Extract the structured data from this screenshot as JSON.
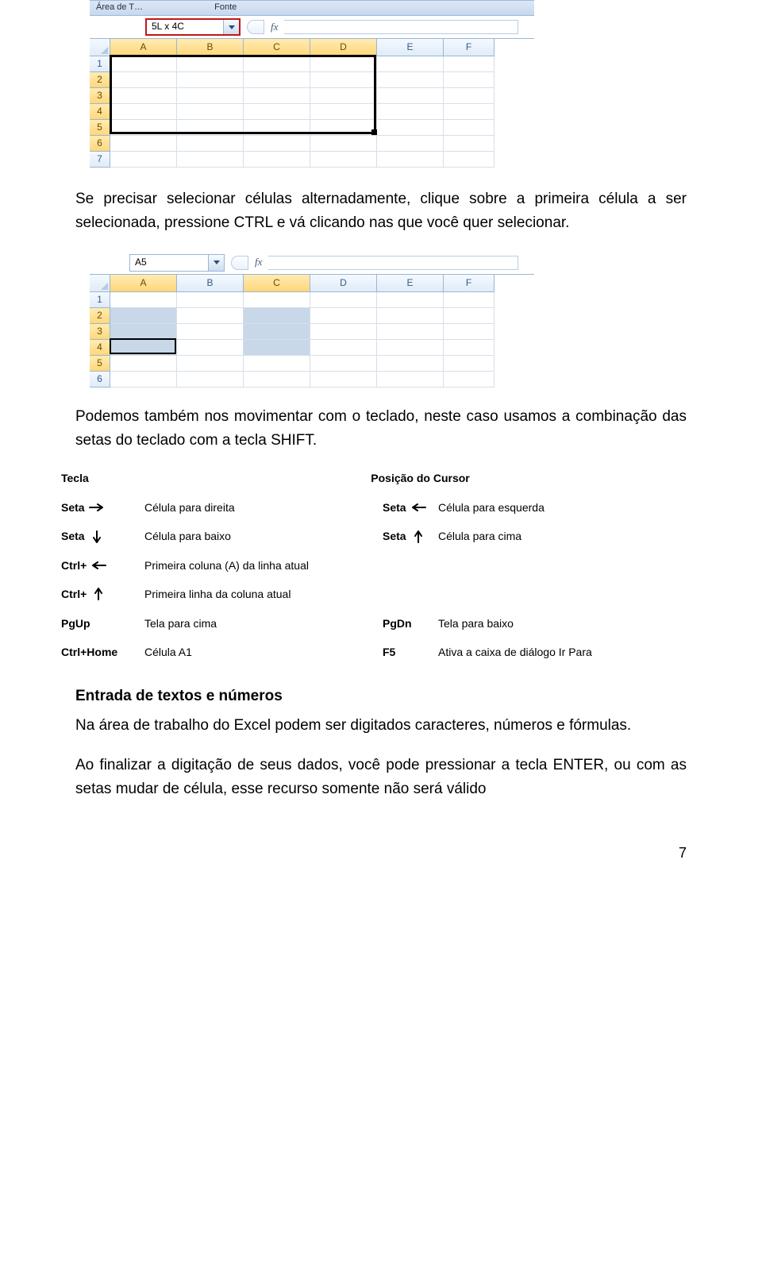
{
  "ribbon": {
    "label1": "Área de T…",
    "label2": "Fonte"
  },
  "shot1": {
    "namebox": "5L x 4C",
    "cols": [
      "A",
      "B",
      "C",
      "D",
      "E",
      "F"
    ],
    "rows": [
      "1",
      "2",
      "3",
      "4",
      "5",
      "6",
      "7"
    ]
  },
  "para1": "Se precisar selecionar células alternadamente, clique sobre a primeira célula a ser selecionada, pressione CTRL e vá clicando nas que você quer selecionar.",
  "shot2": {
    "namebox": "A5",
    "cols": [
      "A",
      "B",
      "C",
      "D",
      "E",
      "F"
    ],
    "rows": [
      "1",
      "2",
      "3",
      "4",
      "5",
      "6"
    ]
  },
  "para2": "Podemos também nos movimentar com o teclado, neste caso usamos a combinação das setas do teclado com a tecla SHIFT.",
  "kb": {
    "head_key": "Tecla",
    "head_pos": "Posição do Cursor",
    "rows": [
      {
        "k1": "Seta",
        "a1": "right",
        "d1": "Célula para direita",
        "k2": "Seta",
        "a2": "left",
        "d2": "Célula para esquerda"
      },
      {
        "k1": "Seta",
        "a1": "down",
        "d1": "Célula para baixo",
        "k2": "Seta",
        "a2": "up",
        "d2": "Célula para cima"
      },
      {
        "k1": "Ctrl+",
        "a1": "left",
        "d1": "Primeira coluna (A) da linha atual",
        "k2": "",
        "a2": "",
        "d2": ""
      },
      {
        "k1": "Ctrl+",
        "a1": "up",
        "d1": "Primeira linha da coluna atual",
        "k2": "",
        "a2": "",
        "d2": ""
      },
      {
        "k1": "PgUp",
        "a1": "",
        "d1": "Tela para cima",
        "k2": "PgDn",
        "a2": "",
        "d2": "Tela para baixo"
      },
      {
        "k1": "Ctrl+Home",
        "a1": "",
        "d1": "Célula A1",
        "k2": "F5",
        "a2": "",
        "d2": "Ativa a caixa de diálogo Ir Para"
      }
    ]
  },
  "section_h": "Entrada de textos e números",
  "para3": "Na área de trabalho do Excel podem ser digitados caracteres, números e fórmulas.",
  "para4": "Ao finalizar a digitação de seus dados, você pode pressionar a tecla ENTER, ou com as setas mudar de célula, esse recurso somente não será válido",
  "page_num": "7"
}
